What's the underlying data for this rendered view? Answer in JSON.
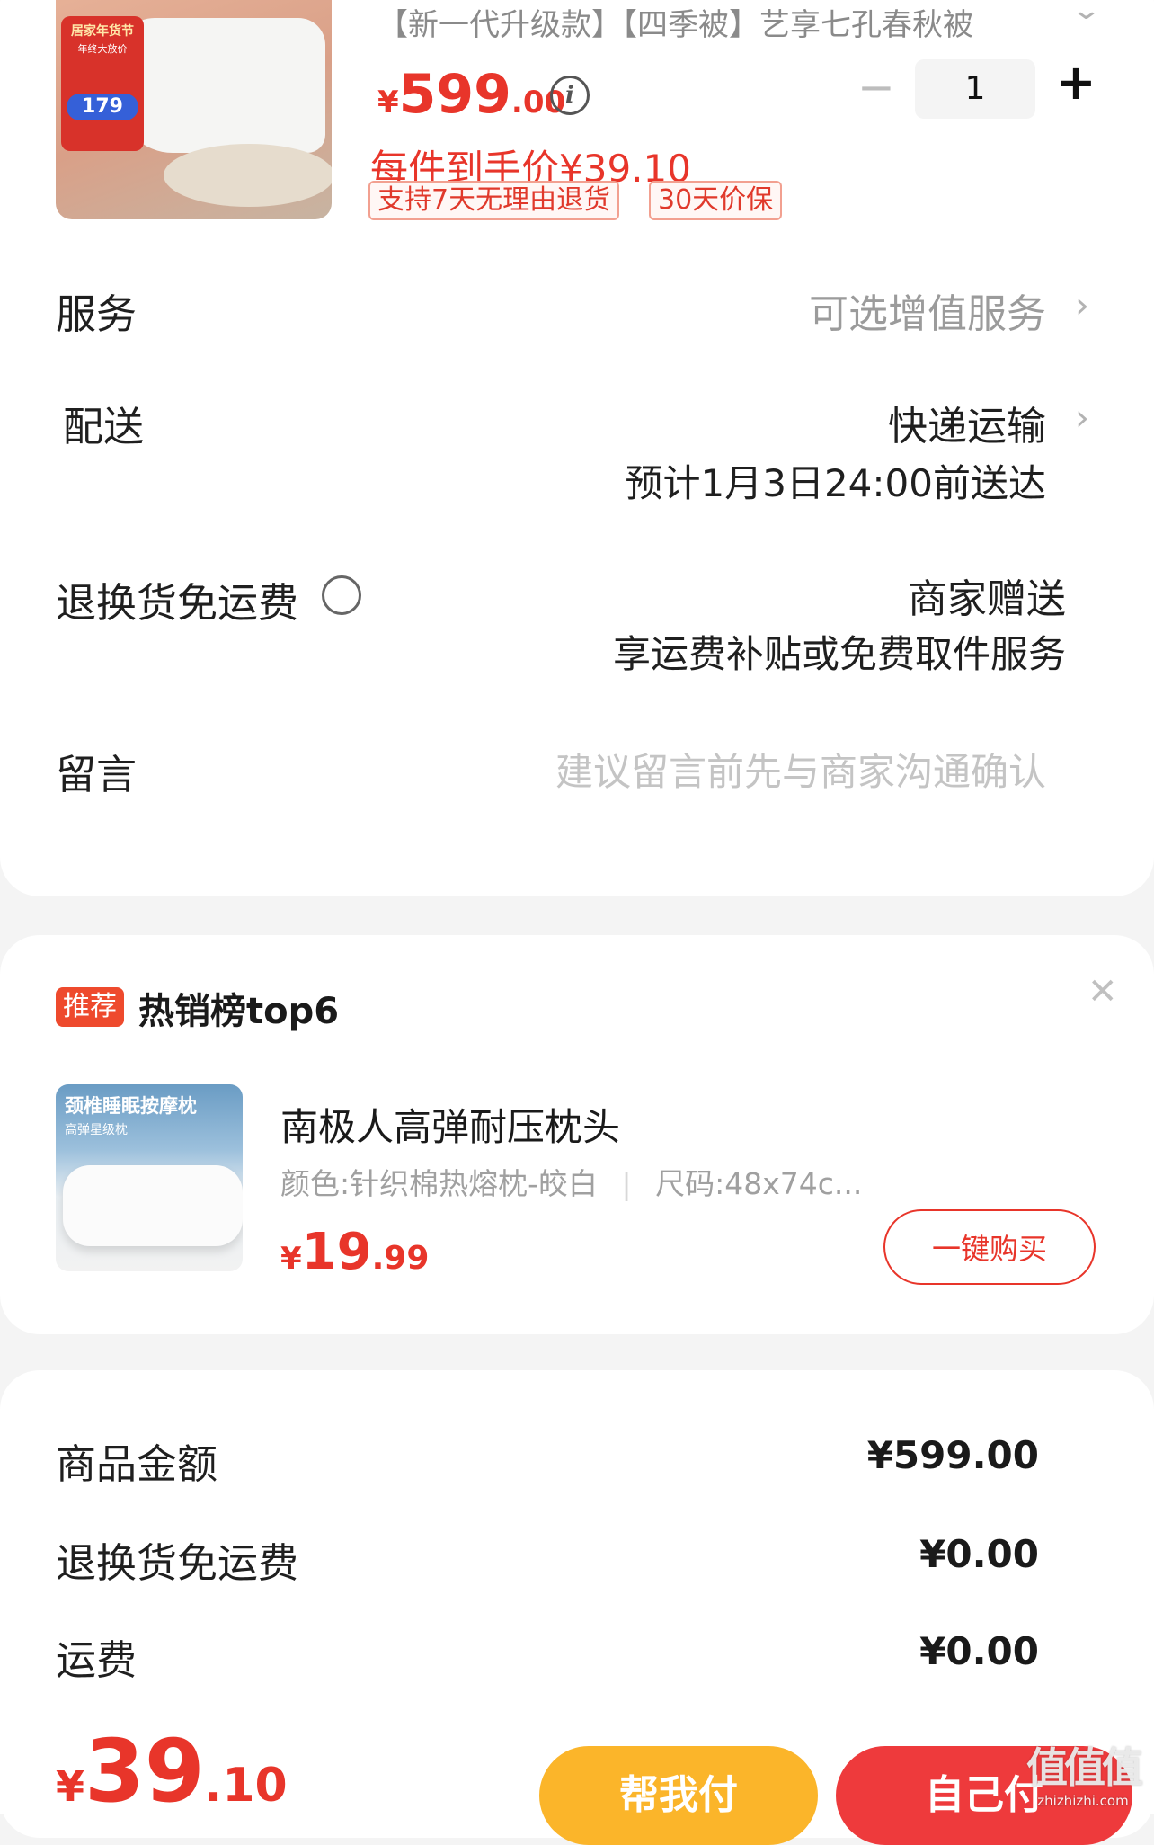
{
  "product": {
    "title": "【新一代升级款】【四季被】艺享七孔春秋被",
    "image_badge_top": "居家年货节",
    "image_badge_sub": "年终大放价",
    "image_badge_price": "179",
    "price_symbol": "¥",
    "price_int": "599",
    "price_dec": ".00",
    "final_price_text": "每件到手价¥39.10",
    "quantity": "1",
    "minus": "−",
    "plus": "+",
    "tags": [
      "支持7天无理由退货",
      "30天价保"
    ]
  },
  "rows": {
    "service_label": "服务",
    "service_value": "可选增值服务",
    "delivery_label": "配送",
    "delivery_value": "快递运输",
    "delivery_eta": "预计1月3日24:00前送达",
    "return_label": "退换货免运费",
    "return_value": "商家赠送",
    "return_desc": "享运费补贴或免费取件服务",
    "message_label": "留言",
    "message_placeholder": "建议留言前先与商家沟通确认"
  },
  "recommend": {
    "badge": "推荐",
    "title": "热销榜top6",
    "item_image_text": "颈椎睡眠按摩枕",
    "item_image_sub": "高弹星级枕",
    "item_name": "南极人高弹耐压枕头",
    "item_spec_color": "颜色:针织棉热熔枕-皎白",
    "item_spec_size": "尺码:48x74c...",
    "item_price_symbol": "¥",
    "item_price_int": "19",
    "item_price_dec": ".99",
    "buy_button": "一键购买"
  },
  "summary": {
    "goods_label": "商品金额",
    "goods_value": "¥599.00",
    "return_label": "退换货免运费",
    "return_value": "¥0.00",
    "shipping_label": "运费",
    "shipping_value": "¥0.00"
  },
  "footer": {
    "total_symbol": "¥",
    "total_int": "39",
    "total_dec": ".10",
    "help_pay": "帮我付",
    "self_pay": "自己付"
  },
  "watermark": {
    "text": "值值值",
    "url": "zhizhizhi.com"
  },
  "colors": {
    "accent": "#e8352a",
    "help_pay": "#fbb52a",
    "self_pay": "#ee3a3c"
  }
}
